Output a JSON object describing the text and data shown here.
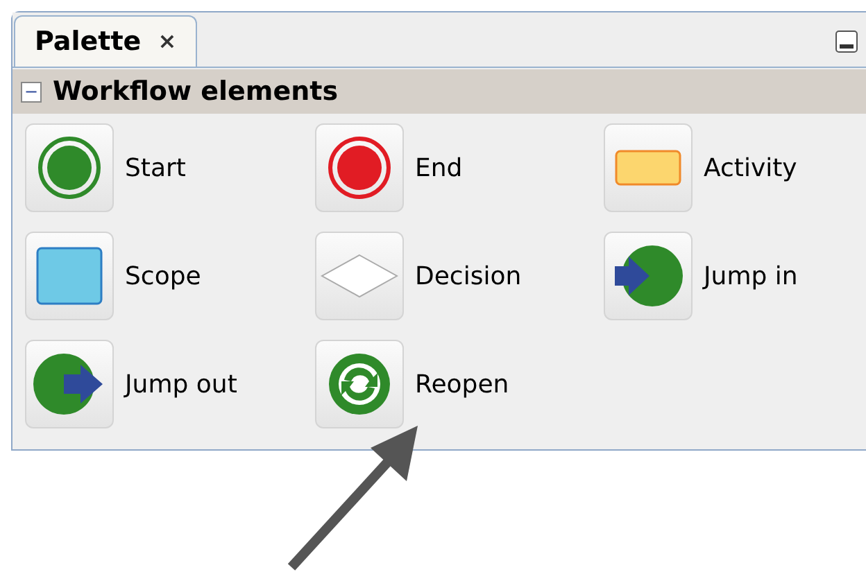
{
  "tab": {
    "label": "Palette",
    "close": "×",
    "selected": true
  },
  "section": {
    "toggle": "−",
    "title": "Workflow elements",
    "expanded": true
  },
  "items": [
    {
      "kind": "start",
      "label": "Start"
    },
    {
      "kind": "end",
      "label": "End"
    },
    {
      "kind": "activity",
      "label": "Activity"
    },
    {
      "kind": "scope",
      "label": "Scope"
    },
    {
      "kind": "decision",
      "label": "Decision"
    },
    {
      "kind": "jumpin",
      "label": "Jump in"
    },
    {
      "kind": "jumpout",
      "label": "Jump out"
    },
    {
      "kind": "reopen",
      "label": "Reopen"
    }
  ]
}
